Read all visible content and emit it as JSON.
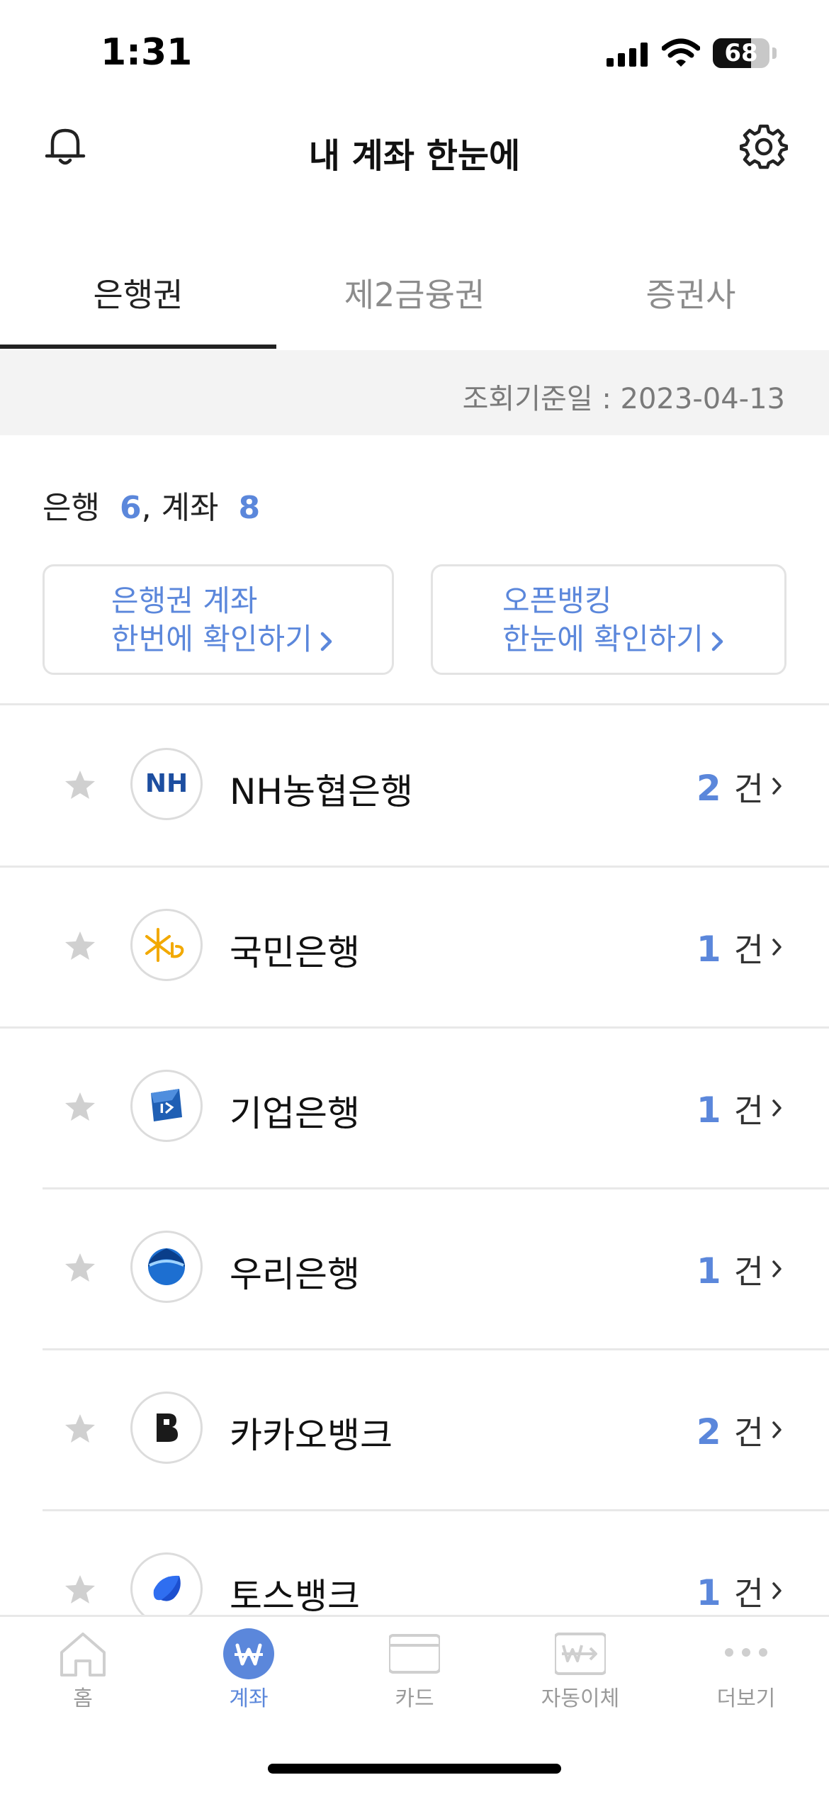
{
  "status_bar": {
    "time": "1:31",
    "battery_level": "68",
    "battery_fraction": 0.68
  },
  "header": {
    "title": "내 계좌 한눈에"
  },
  "tabs": [
    {
      "label": "은행권",
      "active": true
    },
    {
      "label": "제2금융권",
      "active": false
    },
    {
      "label": "증권사",
      "active": false
    }
  ],
  "date_bar": {
    "text": "조회기준일 : 2023-04-13"
  },
  "summary": {
    "bank_label": "은행",
    "bank_count": "6",
    "sep": ", ",
    "account_label": "계좌",
    "account_count": "8"
  },
  "cta_buttons": [
    {
      "line1": "은행권 계좌",
      "line2": "한번에 확인하기"
    },
    {
      "line1": "오픈뱅킹",
      "line2": "한눈에 확인하기"
    }
  ],
  "banks": [
    {
      "name": "NH농협은행",
      "count": "2",
      "unit": "건",
      "logo": "nh-logo",
      "logo_text": "NH"
    },
    {
      "name": "국민은행",
      "count": "1",
      "unit": "건",
      "logo": "kb-logo"
    },
    {
      "name": "기업은행",
      "count": "1",
      "unit": "건",
      "logo": "ibk-logo"
    },
    {
      "name": "우리은행",
      "count": "1",
      "unit": "건",
      "logo": "woori-logo"
    },
    {
      "name": "카카오뱅크",
      "count": "2",
      "unit": "건",
      "logo": "kakaobank-logo"
    },
    {
      "name": "토스뱅크",
      "count": "1",
      "unit": "건",
      "logo": "tossbank-logo"
    }
  ],
  "tabbar": [
    {
      "label": "홈",
      "icon": "home-icon",
      "active": false
    },
    {
      "label": "계좌",
      "icon": "won-icon",
      "active": true
    },
    {
      "label": "카드",
      "icon": "card-icon",
      "active": false
    },
    {
      "label": "자동이체",
      "icon": "auto-transfer-icon",
      "active": false
    },
    {
      "label": "더보기",
      "icon": "more-icon",
      "active": false
    }
  ],
  "colors": {
    "accent": "#5b87db",
    "text": "#111111",
    "muted": "#8c8c8c",
    "divider": "#e8e8e8",
    "date_bar_bg": "#f3f3f3"
  }
}
